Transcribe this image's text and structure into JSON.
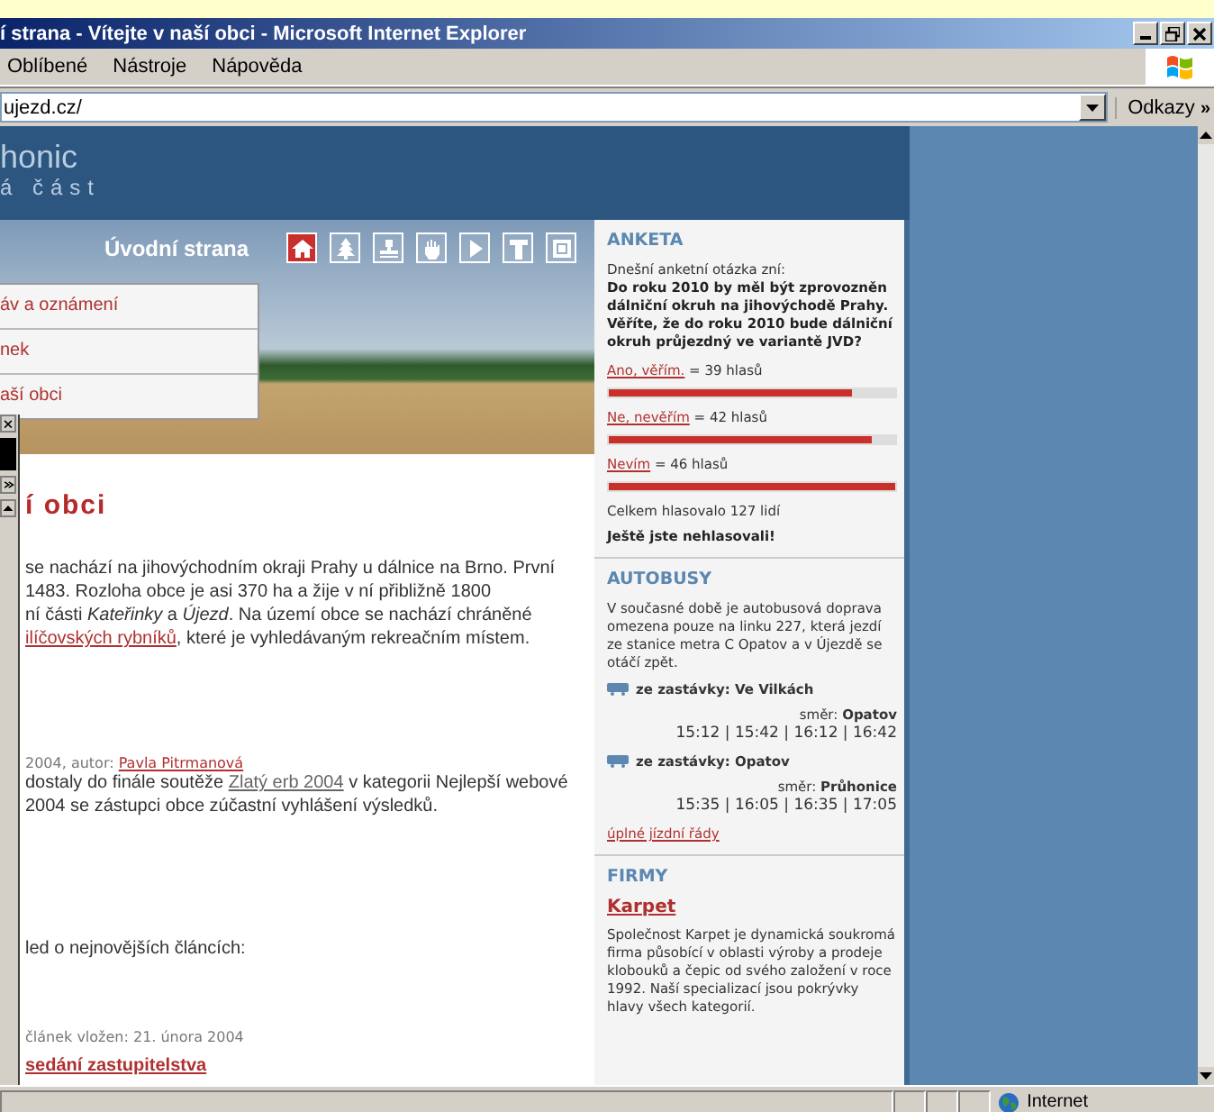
{
  "window": {
    "title": "í strana - Vítejte v naší obci - Microsoft Internet Explorer"
  },
  "menu": [
    "Oblíbené",
    "Nástroje",
    "Nápověda"
  ],
  "address": {
    "value": "ujezd.cz/",
    "links_label": "Odkazy",
    "more": "»"
  },
  "header": {
    "title": "honic",
    "subtitle": "á část"
  },
  "nav": {
    "label": "Úvodní strana",
    "icons": [
      {
        "kind": "house",
        "selected": true
      },
      {
        "kind": "tree",
        "selected": false
      },
      {
        "kind": "stamp",
        "selected": false
      },
      {
        "kind": "hand",
        "selected": false
      },
      {
        "kind": "flag",
        "selected": false
      },
      {
        "kind": "letter",
        "selected": false
      },
      {
        "kind": "frame",
        "selected": false
      }
    ]
  },
  "dropdown": [
    "áv a oznámení",
    "nek",
    "aší obci"
  ],
  "article": {
    "heading": "í obci",
    "intro": [
      [
        {
          "text": "se nachází na jihovýchodním okraji Prahy u dálnice na Brno. První"
        }
      ],
      [
        {
          "text": "1483. Rozloha obce je asi 370 ha a žije v ní přibližně 1800"
        }
      ],
      [
        {
          "text": "ní části *Kateřinky* a *Újezd*. Na území obce se nachází chráněné"
        }
      ],
      [
        {
          "text": "ilíčovských rybníků",
          "link": true
        },
        {
          "text": ", které je vyhledávaným rekreačním místem."
        }
      ]
    ],
    "news_meta": "2004, autor:",
    "news_author": "Pavla Pitrmanová",
    "news_text": [
      [
        {
          "text": "dostaly do finále soutěže "
        },
        {
          "text": "Zlatý erb 2004",
          "link": true
        },
        {
          "text": " v kategorii Nejlepší webové"
        }
      ],
      [
        {
          "text": "2004 se zástupci obce zúčastní vyhlášení výsledků."
        }
      ]
    ],
    "overview": "led o nejnovějších článcích:",
    "latest_meta": "článek vložen: 21. února 2004",
    "latest_title": "sedání zastupitelstva"
  },
  "poll": {
    "title": "ANKETA",
    "intro": "Dnešní anketní otázka zní:",
    "question": "Do roku 2010 by měl být zprovozněn dálniční okruh na jihovýchodě Prahy. Věříte, že do roku 2010 bude dálniční okruh průjezdný ve variantě JVD?",
    "answers": [
      {
        "label": "Ano, věřím.",
        "votes": "= 39 hlasů",
        "level": 0.85
      },
      {
        "label": "Ne, nevěřím",
        "votes": "= 42 hlasů",
        "level": 0.92
      },
      {
        "label": "Nevím",
        "votes": "= 46 hlasů",
        "level": 1.0
      }
    ],
    "total": "Celkem hlasovalo 127 lidí",
    "notice": "Ještě jste nehlasovali!"
  },
  "buses": {
    "title": "AUTOBUSY",
    "text": "V současné době je autobusová doprava omezena pouze na linku 227, která jezdí ze stanice metra C Opatov a v Újezdě se otáčí zpět.",
    "stops": [
      {
        "stop": "ze zastávky: Ve Vilkách",
        "direction_label": "směr:",
        "direction": "Opatov",
        "times": "15:12 | 15:42 | 16:12 | 16:42"
      },
      {
        "stop": "ze zastávky: Opatov",
        "direction_label": "směr:",
        "direction": "Průhonice",
        "times": "15:35 | 16:05 | 16:35 | 17:05"
      }
    ],
    "link": "úplné jízdní řády"
  },
  "firms": {
    "title": "FIRMY",
    "name": "Karpet",
    "text": "Společnost Karpet je dynamická soukromá firma působící v oblasti výroby a prodeje klobouků a čepic od svého založení v roce 1992. Naší specializací jsou pokrývky hlavy všech kategorií."
  },
  "status_bar": {
    "zone": "Internet"
  }
}
